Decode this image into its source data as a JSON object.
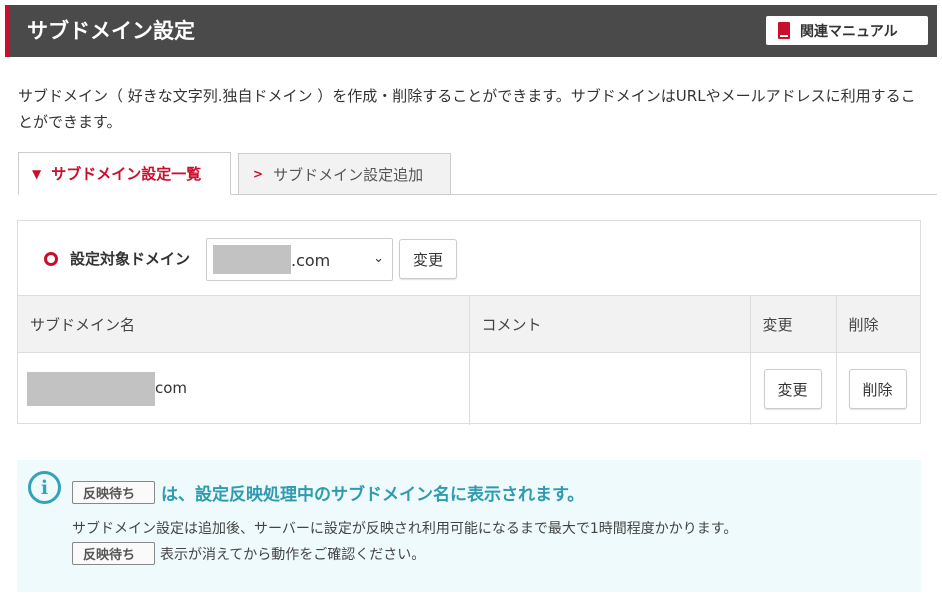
{
  "header": {
    "title": "サブドメイン設定",
    "manual_label": "関連マニュアル",
    "manual_icon": "book-icon",
    "accent_color": "#c8102e",
    "bar_color": "#4a4a4a"
  },
  "description": "サブドメイン（ 好きな文字列.独自ドメイン ）を作成・削除することができます。サブドメインはURLやメールアドレスに利用することができます。",
  "tabs": [
    {
      "label": "サブドメイン設定一覧",
      "active": true,
      "icon": "chevron-down-icon"
    },
    {
      "label": "サブドメイン設定追加",
      "active": false,
      "icon": "chevron-right-icon"
    }
  ],
  "domain_select": {
    "label": "設定対象ドメイン",
    "selected_value": ".com",
    "change_button": "変更"
  },
  "table": {
    "headers": [
      "サブドメイン名",
      "コメント",
      "変更",
      "削除"
    ],
    "rows": [
      {
        "subdomain": "com",
        "comment": "",
        "change_label": "変更",
        "delete_label": "削除"
      }
    ]
  },
  "info": {
    "icon": "info-icon",
    "badge_label": "反映待ち",
    "headline": "は、設定反映処理中のサブドメイン名に表示されます。",
    "line1": "サブドメイン設定は追加後、サーバーに設定が反映され利用可能になるまで最大で1時間程度かかります。",
    "line2": "表示が消えてから動作をご確認ください。",
    "accent_color": "#2e9bb1"
  }
}
